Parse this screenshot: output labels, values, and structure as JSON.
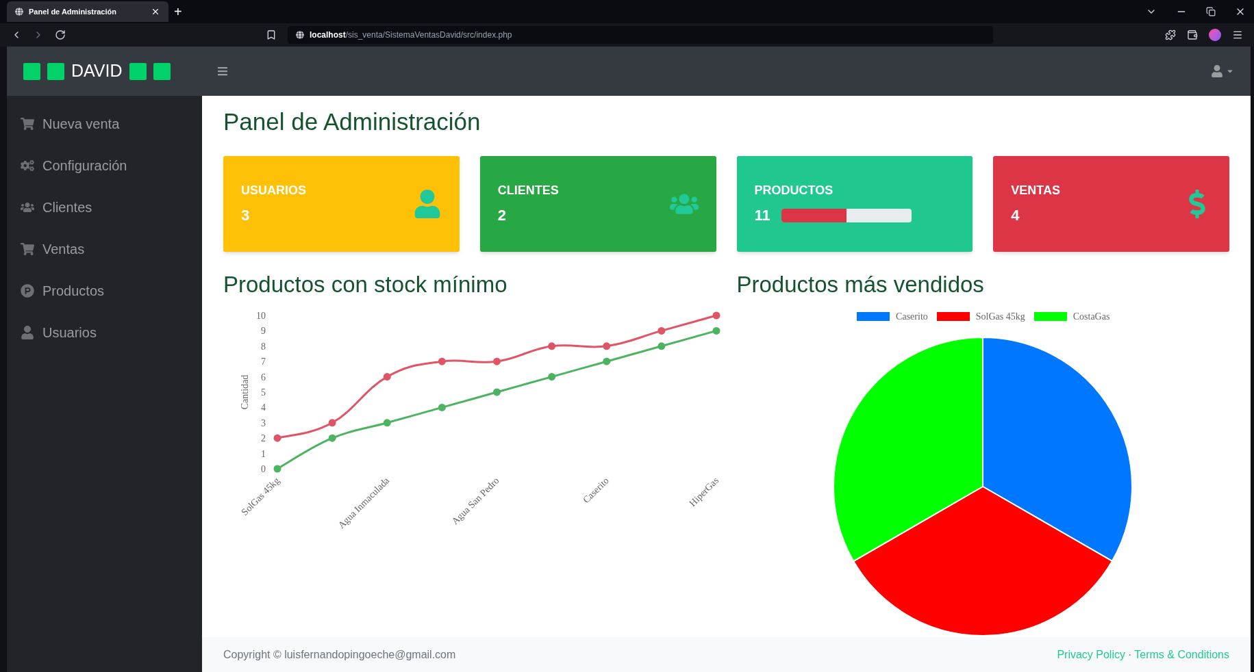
{
  "browser": {
    "tab_title": "Panel de Administración",
    "new_tab": "+",
    "url_host": "localhost",
    "url_path": "/sis_venta/SistemaVentasDavid/src/index.php"
  },
  "navbar": {
    "brand": "DAVID"
  },
  "sidebar": {
    "items": [
      {
        "label": "Nueva venta"
      },
      {
        "label": "Configuración"
      },
      {
        "label": "Clientes"
      },
      {
        "label": "Ventas"
      },
      {
        "label": "Productos"
      },
      {
        "label": "Usuarios"
      }
    ]
  },
  "page_title": "Panel de Administración",
  "cards": [
    {
      "kind": "stat",
      "title": "USUARIOS",
      "value": "3",
      "color": "#ffc107"
    },
    {
      "kind": "stat",
      "title": "CLIENTES",
      "value": "2",
      "color": "#28a745"
    },
    {
      "kind": "progress",
      "title": "PRODUCTOS",
      "value": "11",
      "color": "#20c78f",
      "level": 0.5
    },
    {
      "kind": "stat",
      "title": "VENTAS",
      "value": "4",
      "color": "#dc3545"
    }
  ],
  "line_section": {
    "title": "Productos con stock mínimo",
    "chart_data": {
      "type": "line",
      "ylabel": "Cantidad",
      "categories": [
        "SolGas 45kg",
        null,
        "Agua Inmaculada",
        null,
        "Agua San Pedro",
        null,
        "Caserito",
        null,
        "HiperGas"
      ],
      "ylim": [
        0,
        10
      ],
      "yticks": [
        0,
        1,
        2,
        3,
        4,
        5,
        6,
        7,
        8,
        9,
        10
      ],
      "series": [
        {
          "color": "#e05565",
          "marker": "circle",
          "values": [
            2,
            3,
            6,
            7,
            7,
            8,
            8,
            9,
            10
          ]
        },
        {
          "color": "#4cb460",
          "marker": "circle",
          "values": [
            0,
            2,
            3,
            4,
            5,
            6,
            7,
            8,
            9
          ]
        }
      ]
    }
  },
  "pie_section": {
    "title": "Productos más vendidos",
    "chart_data": {
      "type": "pie",
      "categories": [
        "Caserito",
        "SolGas 45kg",
        "CostaGas"
      ],
      "values": [
        33.33,
        33.33,
        33.34
      ],
      "colors": [
        "#0077ff",
        "#ff0000",
        "#00ff00"
      ],
      "legend": true
    }
  },
  "footer": {
    "copyright": "Copyright © luisfernandopingoeche@gmail.com",
    "links": [
      "Privacy Policy",
      "Terms & Conditions"
    ],
    "separator": "·"
  }
}
